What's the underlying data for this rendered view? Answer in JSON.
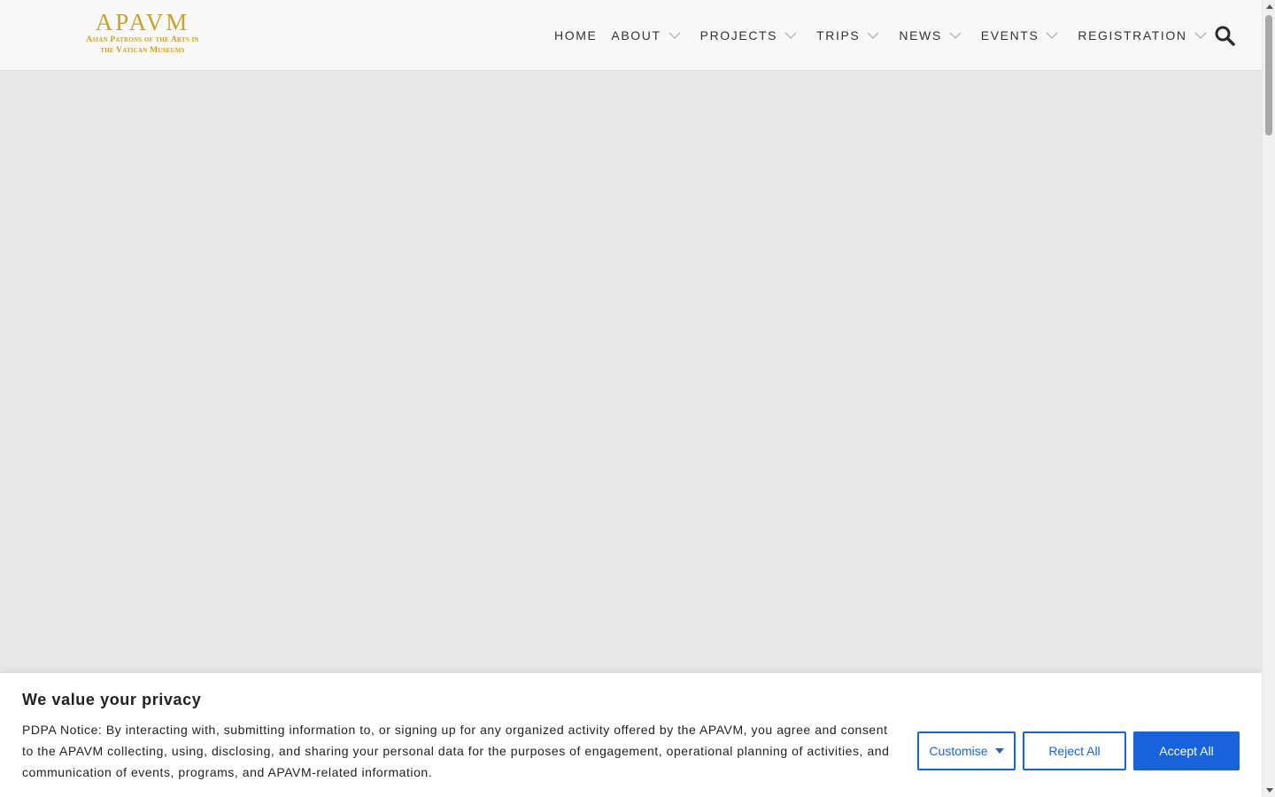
{
  "header": {
    "logo": {
      "main": "APAVM",
      "sub_line1": "Asian Patrons of the Arts in",
      "sub_line2": "the Vatican Museums"
    },
    "nav": [
      {
        "label": "HOME",
        "has_menu": false
      },
      {
        "label": "ABOUT",
        "has_menu": true
      },
      {
        "label": "PROJECTS",
        "has_menu": true
      },
      {
        "label": "TRIPS",
        "has_menu": true
      },
      {
        "label": "NEWS",
        "has_menu": true
      },
      {
        "label": "EVENTS",
        "has_menu": true
      },
      {
        "label": "REGISTRATION",
        "has_menu": true
      }
    ],
    "search_icon": "magnifier-icon"
  },
  "cookie_banner": {
    "title": "We value your privacy",
    "text": "PDPA Notice: By interacting with, submitting information to, or signing up for any organized activity offered by the APAVM, you agree and consent to the APAVM collecting, using, disclosing, and sharing your personal data for the purposes of engagement, operational planning of activities, and communication of events, programs, and APAVM-related information.",
    "buttons": {
      "customise": "Customise",
      "reject": "Reject All",
      "accept": "Accept All"
    }
  },
  "colors": {
    "brand_gold": "#c9a227",
    "accent_blue": "#1863dc",
    "page_bg": "#e8e8e8",
    "header_bg": "#f8f8f8"
  }
}
